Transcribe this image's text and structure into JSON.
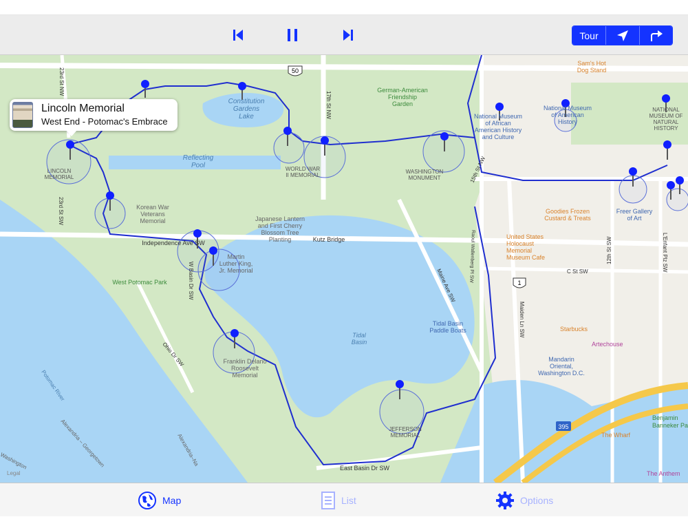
{
  "toolbar": {
    "prev_icon": "skip-back-icon",
    "pause_icon": "pause-icon",
    "next_icon": "skip-forward-icon",
    "tour_label": "Tour",
    "location_icon": "location-arrow-icon",
    "directions_icon": "turn-right-arrow-icon",
    "accent_color": "#1433ff"
  },
  "callout": {
    "title": "Lincoln Memorial",
    "subtitle": "West End - Potomac's Embrace"
  },
  "map": {
    "labels": {
      "lincoln_memorial": [
        "LINCOLN",
        "MEMORIAL"
      ],
      "reflecting_pool": [
        "Reflecting",
        "Pool"
      ],
      "constitution_gardens": [
        "Constitution",
        "Gardens",
        "Lake"
      ],
      "german_american": [
        "German-American",
        "Friendship",
        "Garden"
      ],
      "wwii_memorial": [
        "WORLD WAR",
        "II MEMORIAL"
      ],
      "washington_monument": [
        "WASHINGTON",
        "MONUMENT"
      ],
      "korean_war": [
        "Korean War",
        "Veterans",
        "Memorial"
      ],
      "japanese_lantern": [
        "Japanese Lantern",
        "and First Cherry",
        "Blossom Tree",
        "Planting"
      ],
      "independence_ave": "Independence Ave SW",
      "kutz_bridge": "Kutz Bridge",
      "mlk_memorial": [
        "Martin",
        "Luther King,",
        "Jr. Memorial"
      ],
      "west_potomac_park": "West Potomac Park",
      "tidal_basin": [
        "Tidal",
        "Basin"
      ],
      "fdr_memorial": [
        "Franklin Delano",
        "Roosevelt",
        "Memorial"
      ],
      "jefferson_memorial": [
        "JEFFERSON",
        "MEMORIAL"
      ],
      "east_basin_dr": "East Basin Dr SW",
      "potomac_river": "Potomac River",
      "ohio_dr": "Ohio Dr SW",
      "w_basin_dr": "W Basin Dr SW",
      "maine_ave": "Maine Ave SW",
      "raoul_wallenberg": "Raoul Wallenberg Pl SW",
      "fifteenth_st_nw": "15th St NW",
      "seventeenth_st_nw": "17th St NW",
      "twentythird_st_nw": "23rd St NW",
      "twentythird_st_sw": "23rd St SW",
      "twelfth_st_sw": "12th St SW",
      "lenfant_plz": "L'Enfant Plz SW",
      "maiden_ln": "Maiden Ln SW",
      "c_st_sw": "C St SW",
      "route_50": "50",
      "route_1": "1",
      "route_395": "395",
      "nmaahc": [
        "National Museum",
        "of African",
        "American History",
        "and Culture"
      ],
      "nmah": [
        "National Museum",
        "of American",
        "History"
      ],
      "nmnh": [
        "NATIONAL",
        "MUSEUM OF",
        "NATURAL",
        "HISTORY"
      ],
      "sams_hot_dog": [
        "Sam's Hot",
        "Dog Stand"
      ],
      "goodies_frozen": [
        "Goodies Frozen",
        "Custard & Treats"
      ],
      "freer_gallery": [
        "Freer Gallery",
        "of Art"
      ],
      "holocaust_museum": [
        "United States",
        "Holocaust",
        "Memorial",
        "Museum Cafe"
      ],
      "tidal_basin_boats": [
        "Tidal Basin",
        "Paddle Boats"
      ],
      "starbucks": "Starbucks",
      "artechouse": "Artechouse",
      "mandarin_oriental": [
        "Mandarin",
        "Oriental,",
        "Washington D.C."
      ],
      "the_wharf": "The Wharf",
      "benjamin_banneker": [
        "Benjamin",
        "Banneker Par"
      ],
      "the_anthem": "The Anthem",
      "alexandria_georgetown": "Alexandria – Georgetown",
      "alexandria_na": "Alexandria–Na",
      "washington_bottom": "Washington",
      "legal": "Legal"
    },
    "colors": {
      "park": "#d3e8c5",
      "water": "#a9d5f5",
      "road": "#ffffff",
      "highway": "#f5c84a",
      "route": "#1f2ecf",
      "pin": "#1020ff"
    }
  },
  "tabs": [
    {
      "label": "Map",
      "icon": "globe-icon",
      "color": "#1433ff"
    },
    {
      "label": "List",
      "icon": "list-document-icon",
      "color": "#a7b2ff"
    },
    {
      "label": "Options",
      "icon": "gear-icon",
      "color": "#a7b2ff"
    }
  ]
}
